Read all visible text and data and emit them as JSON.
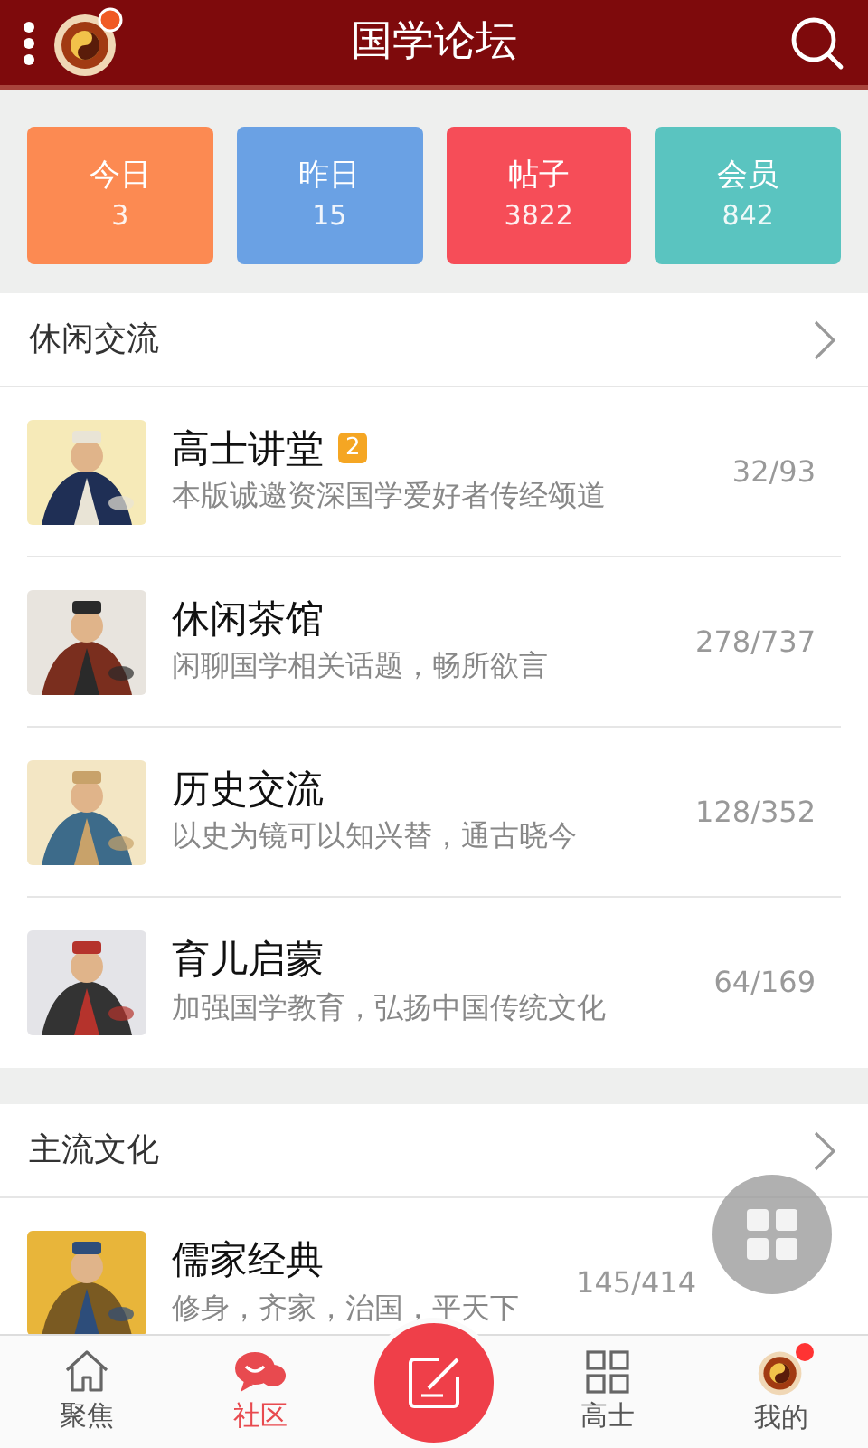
{
  "header": {
    "title": "国学论坛",
    "logo_dot": true
  },
  "stats": [
    {
      "label": "今日",
      "value": "3",
      "color": "#fc8a52"
    },
    {
      "label": "昨日",
      "value": "15",
      "color": "#6aa1e4"
    },
    {
      "label": "帖子",
      "value": "3822",
      "color": "#f64d58"
    },
    {
      "label": "会员",
      "value": "842",
      "color": "#5ac4c0"
    }
  ],
  "sections": [
    {
      "title": "休闲交流",
      "forums": [
        {
          "name": "高士讲堂",
          "badge": "2",
          "description": "本版诚邀资深国学爱好者传经颂道",
          "counts": "32/93"
        },
        {
          "name": "休闲茶馆",
          "description": "闲聊国学相关话题，畅所欲言",
          "counts": "278/737"
        },
        {
          "name": "历史交流",
          "description": "以史为镜可以知兴替，通古晓今",
          "counts": "128/352"
        },
        {
          "name": "育儿启蒙",
          "description": "加强国学教育，弘扬中国传统文化",
          "counts": "64/169"
        }
      ]
    },
    {
      "title": "主流文化",
      "forums": [
        {
          "name": "儒家经典",
          "description": "修身，齐家，治国，平天下",
          "counts": "145/414"
        }
      ]
    }
  ],
  "bottom_nav": [
    {
      "label": "聚焦",
      "kind": "home",
      "selected": false,
      "dot": false
    },
    {
      "label": "社区",
      "kind": "community",
      "selected": true,
      "dot": false
    },
    {
      "kind": "compose",
      "selected": false,
      "dot": false
    },
    {
      "label": "高士",
      "kind": "grid",
      "selected": false,
      "dot": false
    },
    {
      "label": "我的",
      "kind": "profile",
      "selected": false,
      "dot": true
    }
  ]
}
